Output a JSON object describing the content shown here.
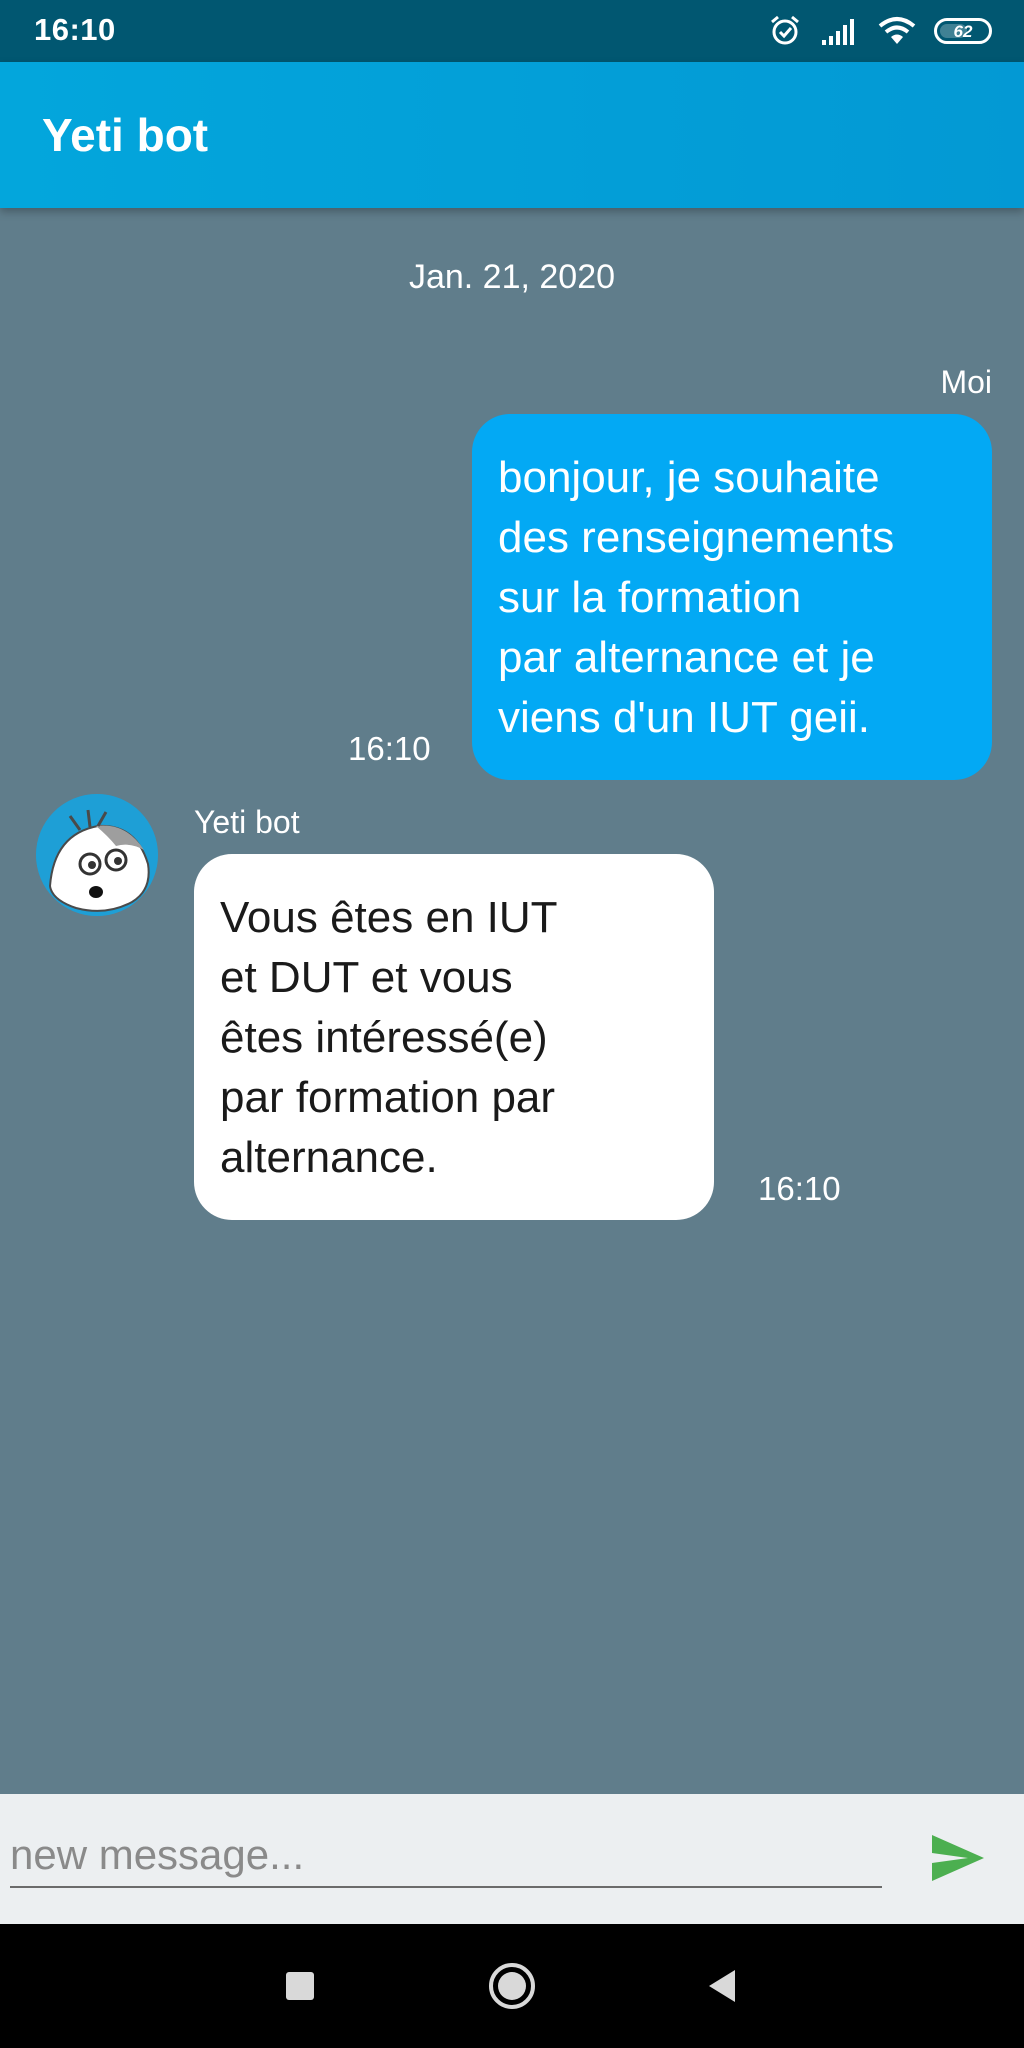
{
  "status_bar": {
    "time": "16:10",
    "battery_level": "62",
    "icons": [
      "alarm-icon",
      "signal-icon",
      "wifi-icon",
      "battery-icon"
    ]
  },
  "app_bar": {
    "title": "Yeti bot"
  },
  "chat": {
    "date": "Jan. 21, 2020",
    "messages": [
      {
        "sender": "Moi",
        "text": "bonjour, je souhaite\ndes renseignements\nsur la formation\npar alternance et je\nviens d'un IUT geii.",
        "time": "16:10",
        "outgoing": true
      },
      {
        "sender": "Yeti bot",
        "avatar_icon": "yeti-avatar-icon",
        "text": "Vous êtes en IUT\net DUT et vous\nêtes intéressé(e)\npar formation par\nalternance.",
        "time": "16:10",
        "outgoing": false
      }
    ]
  },
  "composer": {
    "placeholder": "new message...",
    "value": "",
    "send_icon": "send-icon"
  },
  "nav_bar": {
    "buttons": [
      "recents-icon",
      "home-icon",
      "back-icon"
    ]
  },
  "colors": {
    "status_bar": "#015771",
    "app_bar": "#03a6dc",
    "chat_background": "#607d8b",
    "outgoing_bubble": "#03a9f4",
    "incoming_bubble": "#ffffff",
    "composer_background": "#eceff1",
    "send_icon": "#4caf50"
  }
}
